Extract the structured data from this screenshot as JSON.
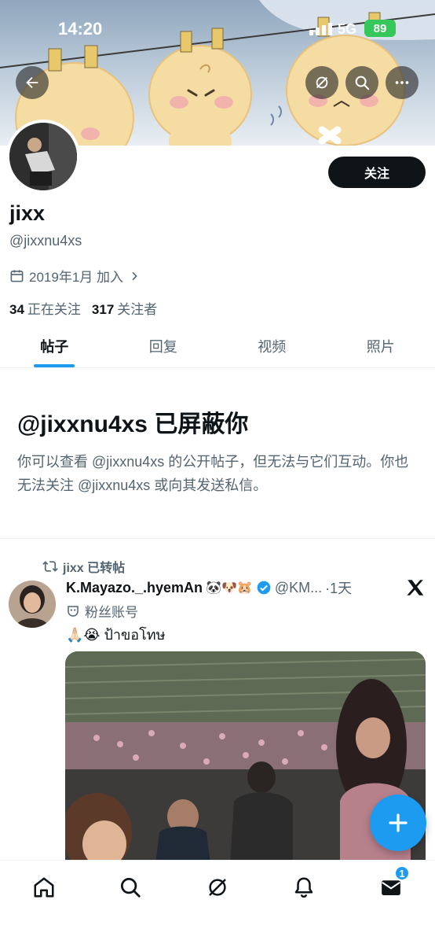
{
  "status_bar": {
    "time": "14:20",
    "network": "5G",
    "battery": "89"
  },
  "profile": {
    "display_name": "jixx",
    "handle": "@jixxnu4xs",
    "joined": "2019年1月 加入",
    "following_count": "34",
    "following_label": "正在关注",
    "followers_count": "317",
    "followers_label": "关注者",
    "follow_button": "关注"
  },
  "tabs": [
    {
      "label": "帖子",
      "active": true
    },
    {
      "label": "回复",
      "active": false
    },
    {
      "label": "视频",
      "active": false
    },
    {
      "label": "照片",
      "active": false
    }
  ],
  "blocked": {
    "title": "@jixxnu4xs 已屏蔽你",
    "description": "你可以查看 @jixxnu4xs 的公开帖子，但无法与它们互动。你也无法关注 @jixxnu4xs 或向其发送私信。"
  },
  "post": {
    "repost_label": "jixx 已转帖",
    "author": "K.Mayazo._.hyemAn",
    "author_emoji": "🐼🐶🐹",
    "handle": "@KM...",
    "time": "·1天",
    "fan_label": "粉丝账号",
    "text": "🙏🏻😭 ป้าขอโทษ"
  },
  "nav": {
    "messages_badge": "1"
  },
  "icons": {
    "back": "arrow-left-icon",
    "grok": "grok-icon",
    "search": "search-icon",
    "more": "more-icon",
    "calendar": "calendar-icon",
    "repost": "repost-icon",
    "verified": "verified-badge-icon",
    "x": "x-logo-icon",
    "fan": "mask-icon",
    "compose": "plus-icon",
    "home": "home-icon",
    "bell": "bell-icon",
    "mail": "mail-icon"
  },
  "colors": {
    "accent": "#1d9bf0",
    "text": "#0f1419",
    "muted": "#536471",
    "battery": "#35c759"
  }
}
